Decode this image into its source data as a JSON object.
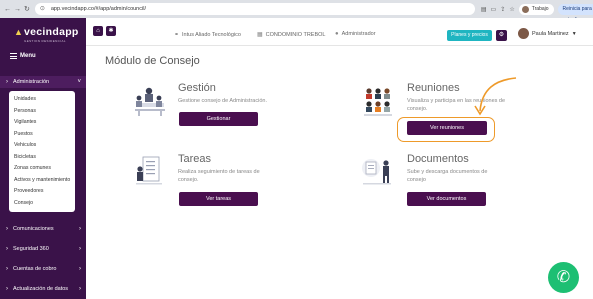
{
  "browser": {
    "url": "app.vecindapp.co/#/app/admin/council/",
    "work_label": "Trabajo",
    "update_label": "Reinicia para actualizar"
  },
  "sidebar": {
    "logo": "vecindapp",
    "logo_sub": "GESTION RESIDENCIAL",
    "menu_label": "Menu",
    "admin_label": "Administración",
    "admin_items": [
      "Unidades",
      "Personas",
      "Vigilantes",
      "Puestos",
      "Vehiculos",
      "Bicicletas",
      "Zonas comunes",
      "Activos y mantenimiento",
      "Proveedores",
      "Consejo"
    ],
    "sections": [
      "Comunicaciones",
      "Seguridad 360",
      "Cuentas de cobro",
      "Actualización de datos"
    ]
  },
  "topbar": {
    "ally": "Intus Aliado Tecnológico",
    "building": "CONDOMINIO TREBOL",
    "role": "Administrador",
    "plans_label": "Planes y precios",
    "user_name": "Paula Martinez"
  },
  "page": {
    "title": "Módulo de Consejo",
    "cards": [
      {
        "title": "Gestión",
        "desc1": "Gestione consejo de Administración.",
        "desc2": "",
        "button": "Gestionar"
      },
      {
        "title": "Reuniones",
        "desc1": "Visualiza y participa en las reuniones de",
        "desc2": "consejo.",
        "button": "Ver reuniones"
      },
      {
        "title": "Tareas",
        "desc1": "Realiza seguimiento de tareas de",
        "desc2": "consejo.",
        "button": "Ver tareas"
      },
      {
        "title": "Documentos",
        "desc1": "Sube y descarga documentos de",
        "desc2": "consejo",
        "button": "Ver documentos"
      }
    ]
  },
  "colors": {
    "sidebar": "#3a1249",
    "button": "#4a0f4f",
    "highlight": "#ee9a2a",
    "plans": "#1fb5c1",
    "whatsapp": "#1dbf73"
  }
}
